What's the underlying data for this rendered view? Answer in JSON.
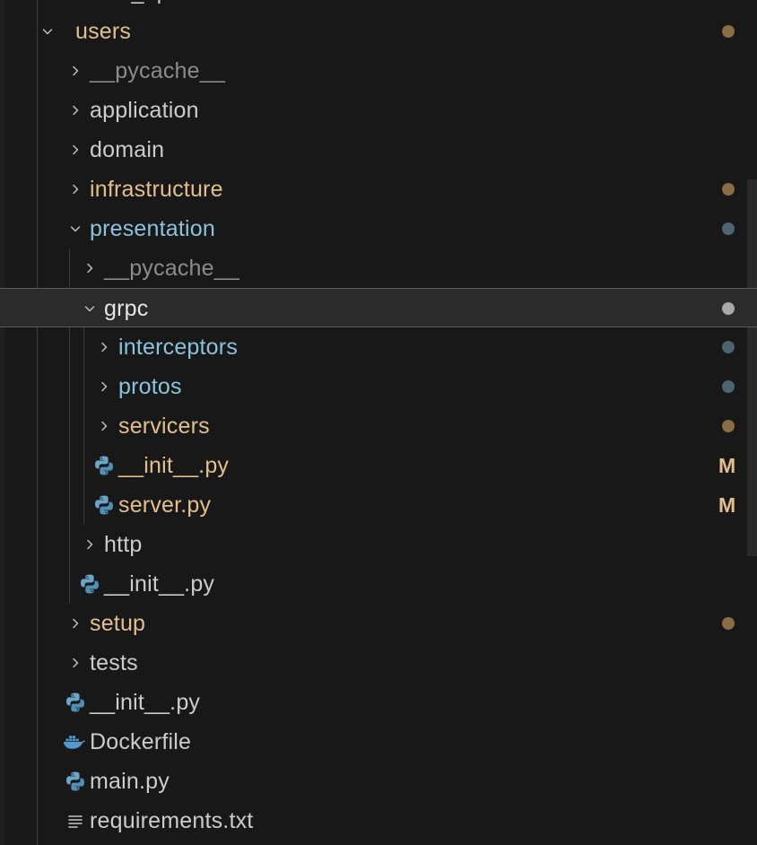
{
  "colors": {
    "background": "#181818",
    "folder_modified": "#e2c08d",
    "folder_untracked": "#89c4dc",
    "text_default": "#cccccc",
    "text_ignored": "#8c8c8c",
    "dot_modified": "#8a6d45",
    "dot_blue": "#4b6470",
    "dot_selected": "#a8a8a8"
  },
  "partial_top_label": "web_api",
  "tree": [
    {
      "label": "users",
      "kind": "folder",
      "expanded": true,
      "depth": 0,
      "status": "modified",
      "dot": "modified"
    },
    {
      "label": "__pycache__",
      "kind": "folder",
      "expanded": false,
      "depth": 1,
      "status": "ignored"
    },
    {
      "label": "application",
      "kind": "folder",
      "expanded": false,
      "depth": 1,
      "status": "default"
    },
    {
      "label": "domain",
      "kind": "folder",
      "expanded": false,
      "depth": 1,
      "status": "default"
    },
    {
      "label": "infrastructure",
      "kind": "folder",
      "expanded": false,
      "depth": 1,
      "status": "modified",
      "dot": "modified"
    },
    {
      "label": "presentation",
      "kind": "folder",
      "expanded": true,
      "depth": 1,
      "status": "untracked",
      "dot": "blue"
    },
    {
      "label": "__pycache__",
      "kind": "folder",
      "expanded": false,
      "depth": 2,
      "status": "ignored"
    },
    {
      "label": "grpc",
      "kind": "folder",
      "expanded": true,
      "depth": 2,
      "status": "selected",
      "dot": "selected",
      "selected": true
    },
    {
      "label": "interceptors",
      "kind": "folder",
      "expanded": false,
      "depth": 3,
      "status": "untracked",
      "dot": "blue"
    },
    {
      "label": "protos",
      "kind": "folder",
      "expanded": false,
      "depth": 3,
      "status": "untracked",
      "dot": "blue"
    },
    {
      "label": "servicers",
      "kind": "folder",
      "expanded": false,
      "depth": 3,
      "status": "modified",
      "dot": "modified"
    },
    {
      "label": "__init__.py",
      "kind": "python",
      "depth": 3,
      "status": "modified",
      "badge": "M"
    },
    {
      "label": "server.py",
      "kind": "python",
      "depth": 3,
      "status": "modified",
      "badge": "M"
    },
    {
      "label": "http",
      "kind": "folder",
      "expanded": false,
      "depth": 2,
      "status": "default"
    },
    {
      "label": "__init__.py",
      "kind": "python",
      "depth": 2,
      "status": "default"
    },
    {
      "label": "setup",
      "kind": "folder",
      "expanded": false,
      "depth": 1,
      "status": "modified",
      "dot": "modified"
    },
    {
      "label": "tests",
      "kind": "folder",
      "expanded": false,
      "depth": 1,
      "status": "default"
    },
    {
      "label": "__init__.py",
      "kind": "python",
      "depth": 1,
      "status": "default"
    },
    {
      "label": "Dockerfile",
      "kind": "docker",
      "depth": 1,
      "status": "default"
    },
    {
      "label": "main.py",
      "kind": "python",
      "depth": 1,
      "status": "default"
    },
    {
      "label": "requirements.txt",
      "kind": "text",
      "depth": 1,
      "status": "default"
    }
  ]
}
